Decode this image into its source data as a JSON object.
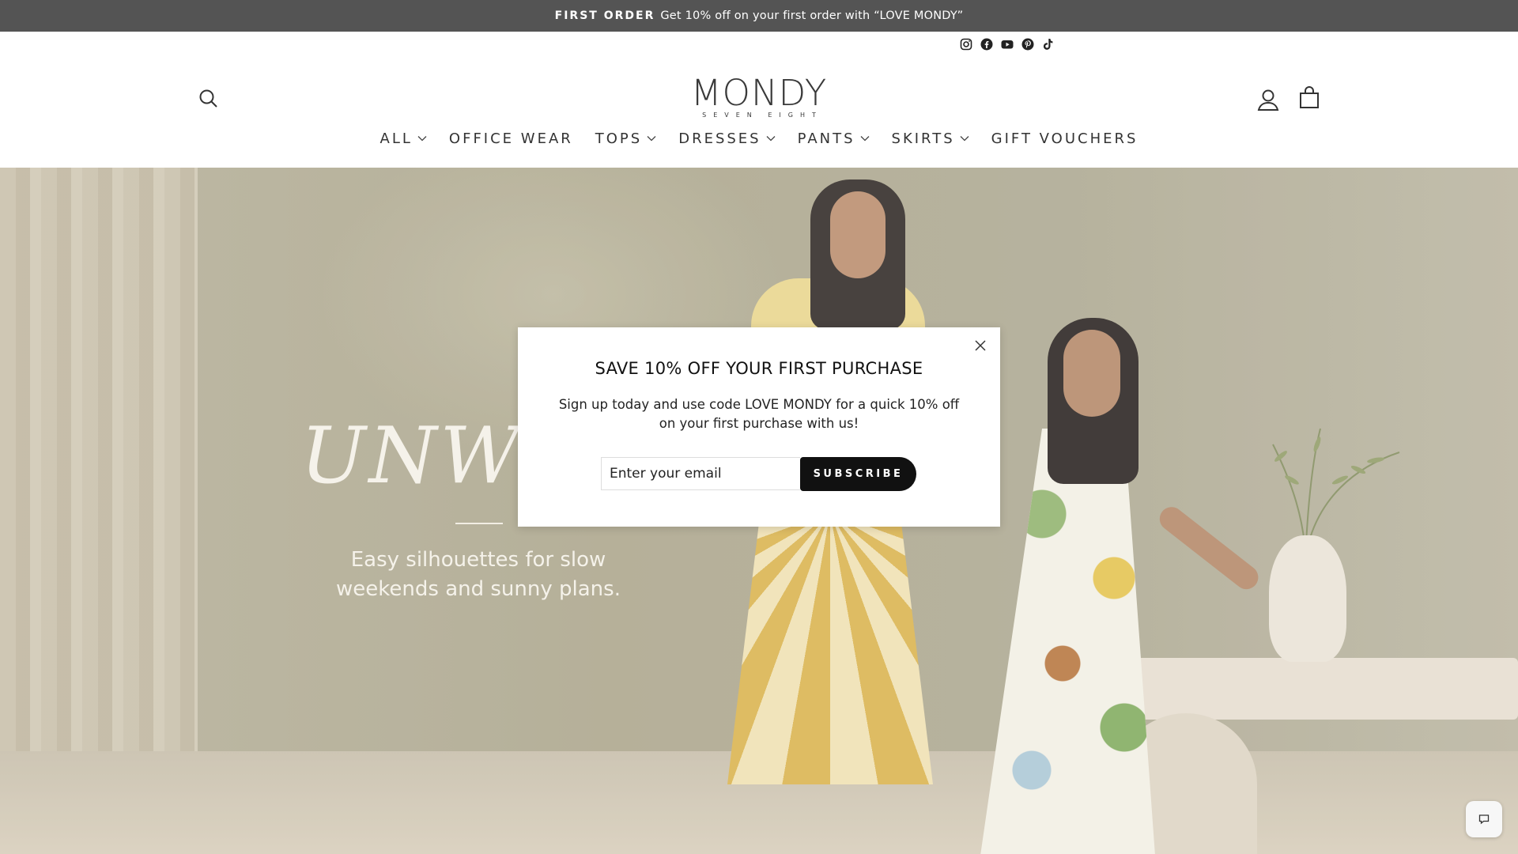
{
  "announcement": {
    "strong": "FIRST ORDER",
    "text": "Get 10% off on your first order with “LOVE MONDY”"
  },
  "social": [
    "instagram-icon",
    "facebook-icon",
    "youtube-icon",
    "pinterest-icon",
    "tiktok-icon"
  ],
  "logo": {
    "main": "MONDY",
    "sub": "SEVEN EIGHT"
  },
  "nav": {
    "items": [
      {
        "label": "ALL",
        "has_dropdown": true
      },
      {
        "label": "OFFICE WEAR",
        "has_dropdown": false
      },
      {
        "label": "TOPS",
        "has_dropdown": true
      },
      {
        "label": "DRESSES",
        "has_dropdown": true
      },
      {
        "label": "PANTS",
        "has_dropdown": true
      },
      {
        "label": "SKIRTS",
        "has_dropdown": true
      },
      {
        "label": "GIFT VOUCHERS",
        "has_dropdown": false
      }
    ]
  },
  "hero": {
    "title": "UNWO",
    "subtitle": "Easy silhouettes for slow weekends and sunny plans."
  },
  "modal": {
    "title": "SAVE 10% OFF YOUR FIRST PURCHASE",
    "text": "Sign up today and use code LOVE MONDY for a quick 10% off on your first purchase with us!",
    "email_placeholder": "Enter your email",
    "subscribe_label": "SUBSCRIBE"
  },
  "colors": {
    "announcement_bg": "#545454",
    "button_bg": "#111111",
    "hero_tint": "#aba68e"
  }
}
